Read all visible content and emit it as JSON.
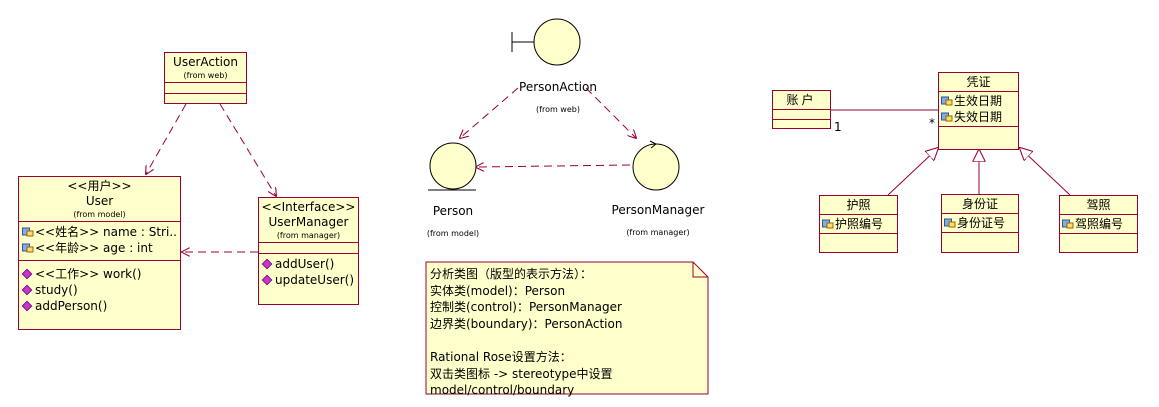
{
  "colors": {
    "class_fill": "#ffffcc",
    "border": "#990033",
    "operation_icon": "#cc33cc",
    "attribute_icon": "#3366cc"
  },
  "user_action": {
    "name": "UserAction",
    "from": "(from web)"
  },
  "user": {
    "stereotype": "<<用户>>",
    "name": "User",
    "from": "(from model)",
    "attributes": [
      "<<姓名>> name : Stri...",
      "<<年龄>> age : int"
    ],
    "operations": [
      "<<工作>> work()",
      "study()",
      "addPerson()"
    ]
  },
  "user_manager": {
    "stereotype": "<<Interface>>",
    "name": "UserManager",
    "from": "(from manager)",
    "operations": [
      "addUser()",
      "updateUser()"
    ]
  },
  "person_action": {
    "name": "PersonAction",
    "from": "(from web)",
    "icon": "boundary-icon"
  },
  "person": {
    "name": "Person",
    "from": "(from model)",
    "icon": "entity-icon"
  },
  "person_manager": {
    "name": "PersonManager",
    "from": "(from manager)",
    "icon": "control-icon"
  },
  "note": {
    "lines": [
      "分析类图（版型的表示方法）：",
      "实体类(model)：Person",
      "控制类(control)：PersonManager",
      "边界类(boundary)：PersonAction",
      "",
      "Rational Rose设置方法：",
      "双击类图标 -> stereotype中设置",
      "model/control/boundary"
    ]
  },
  "account": {
    "name": "账户"
  },
  "credential": {
    "name": "凭证",
    "attributes": [
      "生效日期",
      "失效日期"
    ]
  },
  "association": {
    "account_multiplicity": "1",
    "credential_multiplicity": "*"
  },
  "passport": {
    "name": "护照",
    "attributes": [
      "护照编号"
    ]
  },
  "id_card": {
    "name": "身份证",
    "attributes": [
      "身份证号"
    ]
  },
  "driver_license": {
    "name": "驾照",
    "attributes": [
      "驾照编号"
    ]
  }
}
